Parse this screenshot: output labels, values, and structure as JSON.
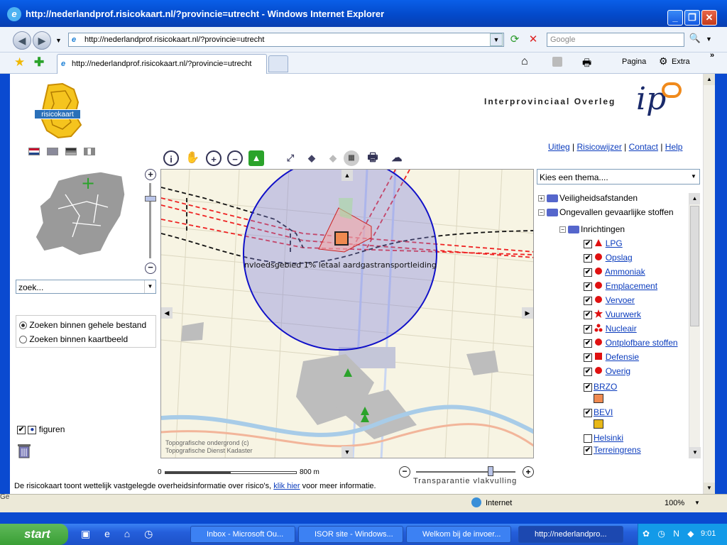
{
  "window": {
    "title": "http://nederlandprof.risicokaart.nl/?provincie=utrecht - Windows Internet Explorer"
  },
  "addressbar": {
    "url": "http://nederlandprof.risicokaart.nl/?provincie=utrecht",
    "search_placeholder": "Google"
  },
  "tabs": [
    {
      "label": "http://nederlandprof.risicokaart.nl/?provincie=utrecht"
    }
  ],
  "toolbar": {
    "page_label": "Pagina",
    "extra_label": "Extra"
  },
  "header": {
    "logo_text": "risicokaart",
    "ipo_text": "Interprovinciaal Overleg",
    "ipo_logo": "ip"
  },
  "top_links": [
    "Uitleg",
    "Risicowijzer",
    "Contact",
    "Help"
  ],
  "search": {
    "value": "zoek...",
    "options": [
      "Zoeken binnen gehele bestand",
      "Zoeken binnen kaartbeeld"
    ],
    "selected_index": 0
  },
  "layers": {
    "figuren_label": "figuren"
  },
  "theme_select": {
    "value": "Kies een thema...."
  },
  "legend": {
    "groups": [
      {
        "label": "Veiligheidsafstanden",
        "expanded": false
      },
      {
        "label": "Ongevallen gevaarlijke stoffen",
        "expanded": true
      }
    ],
    "subgroup": "Inrichtingen",
    "items": [
      {
        "label": "LPG",
        "color": "#e01010",
        "shape": "triangle"
      },
      {
        "label": "Opslag",
        "color": "#e01010",
        "shape": "circle"
      },
      {
        "label": "Ammoniak",
        "color": "#e01010",
        "shape": "circle"
      },
      {
        "label": "Emplacement",
        "color": "#e01010",
        "shape": "circle"
      },
      {
        "label": "Vervoer",
        "color": "#e01010",
        "shape": "circle"
      },
      {
        "label": "Vuurwerk",
        "color": "#e01010",
        "shape": "star"
      },
      {
        "label": "Nucleair",
        "color": "#e01010",
        "shape": "trefoil"
      },
      {
        "label": "Ontplofbare stoffen",
        "color": "#e01010",
        "shape": "circle"
      },
      {
        "label": "Defensie",
        "color": "#e01010",
        "shape": "square"
      },
      {
        "label": "Overig",
        "color": "#e01010",
        "shape": "circle"
      }
    ],
    "extra": [
      {
        "label": "BRZO",
        "swatch": "#f08a50",
        "checked": true
      },
      {
        "label": "BEVI",
        "swatch": "#e8b818",
        "checked": true
      },
      {
        "label": "Helsinki",
        "swatch": "",
        "checked": false
      },
      {
        "label": "Terreingrens",
        "swatch": "",
        "checked": true
      }
    ]
  },
  "map": {
    "circle_label": "nvloedsgebied 1% letaal aardgastransportleiding",
    "attribution1": "Topografische ondergrond (c)",
    "attribution2": "Topografische Dienst Kadaster",
    "scale_start": "0",
    "scale_end": "800 m",
    "transparency_label": "Transparantie vlakvulling",
    "transparency_level": 0.75,
    "circle_fill": "#7f82e0",
    "circle_stroke": "#1010c8"
  },
  "footer": {
    "text_before": "De risicokaart toont wettelijk vastgelegde overheidsinformatie over risico's,",
    "link": "klik hier",
    "text_after": "voor meer informatie."
  },
  "status": {
    "left": "Ge",
    "zone": "Internet",
    "zoom": "100%"
  },
  "taskbar": {
    "start": "start",
    "tasks": [
      "Inbox - Microsoft Ou...",
      "ISOR site - Windows...",
      "Welkom bij de invoer...",
      "http://nederlandpro..."
    ],
    "time": "9:01"
  }
}
